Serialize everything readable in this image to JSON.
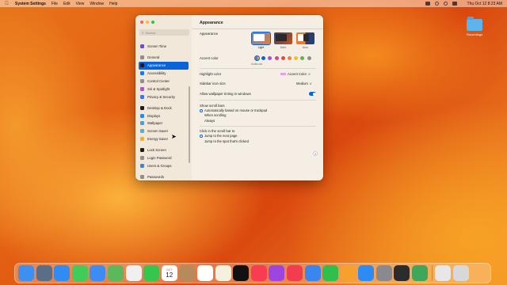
{
  "menubar": {
    "apple_icon": "apple-logo",
    "items": [
      "System Settings",
      "File",
      "Edit",
      "View",
      "Window",
      "Help"
    ],
    "clock": "Thu Oct 12  8:23 AM"
  },
  "desktop": {
    "folder_label": "Recordings"
  },
  "window": {
    "search_placeholder": "Search",
    "sidebar": [
      {
        "label": "Screen Time",
        "color": "#6f4bd8"
      },
      {
        "label": "General",
        "color": "#8e8e93"
      },
      {
        "label": "Appearance",
        "color": "#1c1c1e",
        "selected": true
      },
      {
        "label": "Accessibility",
        "color": "#0a7cff"
      },
      {
        "label": "Control Center",
        "color": "#8e8e93"
      },
      {
        "label": "Siri & Spotlight",
        "color": "#b44fd8"
      },
      {
        "label": "Privacy & Security",
        "color": "#3478f6"
      },
      {
        "label": "Desktop & Dock",
        "color": "#1c1c1e"
      },
      {
        "label": "Displays",
        "color": "#1f8cff"
      },
      {
        "label": "Wallpaper",
        "color": "#35a8f0"
      },
      {
        "label": "Screen Saver",
        "color": "#3fb7d7"
      },
      {
        "label": "Energy Saver",
        "color": "#ffb300"
      },
      {
        "label": "Lock Screen",
        "color": "#1c1c1e"
      },
      {
        "label": "Login Password",
        "color": "#8e8e93"
      },
      {
        "label": "Users & Groups",
        "color": "#3b82f6"
      },
      {
        "label": "Passwords",
        "color": "#8e8e93"
      }
    ],
    "content": {
      "title": "Appearance",
      "appearance_label": "Appearance",
      "appearance_options": [
        {
          "caption": "Light",
          "selected": true
        },
        {
          "caption": "Dark",
          "selected": false
        },
        {
          "caption": "Auto",
          "selected": false
        }
      ],
      "accent_label": "Accent color",
      "accent_caption": "Multicolor",
      "accent_colors": [
        "#0a64d8",
        "#a451d4",
        "#e0408d",
        "#e8463b",
        "#f2852b",
        "#f4c01e",
        "#58b947",
        "#8e8e93"
      ],
      "highlight_label": "Highlight color",
      "highlight_value": "Accent Color",
      "icon_size_label": "Sidebar icon size",
      "icon_size_value": "Medium",
      "tinting_label": "Allow wallpaper tinting in windows",
      "tinting_on": true,
      "scroll_bars_label": "Show scroll bars",
      "scroll_bars_options": [
        {
          "label": "Automatically based on mouse or trackpad",
          "selected": true
        },
        {
          "label": "When scrolling",
          "selected": false
        },
        {
          "label": "Always",
          "selected": false
        }
      ],
      "click_label": "Click in the scroll bar to",
      "click_options": [
        {
          "label": "Jump to the next page",
          "selected": true
        },
        {
          "label": "Jump to the spot that's clicked",
          "selected": false
        }
      ],
      "help_glyph": "?"
    }
  },
  "dock": [
    {
      "name": "finder",
      "color": "#3d8ff0"
    },
    {
      "name": "launchpad",
      "color": "#5a6e88"
    },
    {
      "name": "safari",
      "color": "#2f8cf2"
    },
    {
      "name": "messages",
      "color": "#3fcc58"
    },
    {
      "name": "mail",
      "color": "#3b8df5"
    },
    {
      "name": "maps",
      "color": "#5bb85c"
    },
    {
      "name": "photos",
      "color": "#f0f0f0"
    },
    {
      "name": "facetime",
      "color": "#35c64d"
    },
    {
      "name": "calendar",
      "color": "#ffffff",
      "text_top": "OCT",
      "text": "12"
    },
    {
      "name": "contacts",
      "color": "#b78a5c"
    },
    {
      "name": "reminders",
      "color": "#ffffff"
    },
    {
      "name": "notes",
      "color": "#f6f1df"
    },
    {
      "name": "apple-tv",
      "color": "#111111"
    },
    {
      "name": "music",
      "color": "#fa3c53"
    },
    {
      "name": "podcasts",
      "color": "#9d45de"
    },
    {
      "name": "news",
      "color": "#f23d4e"
    },
    {
      "name": "keynote",
      "color": "#3a86f0"
    },
    {
      "name": "numbers",
      "color": "#2fbf4a"
    },
    {
      "name": "pages",
      "color": "#f6a02d"
    },
    {
      "name": "app-store",
      "color": "#2d8bf4"
    },
    {
      "name": "system-settings",
      "color": "#8a8a8e"
    },
    {
      "name": "quicktime",
      "color": "#2c2c2e"
    },
    {
      "name": "preview",
      "color": "#3fa65a"
    },
    {
      "name": "downloads",
      "color": "#e7e7e7"
    },
    {
      "name": "trash",
      "color": "#d8d8d8"
    }
  ]
}
